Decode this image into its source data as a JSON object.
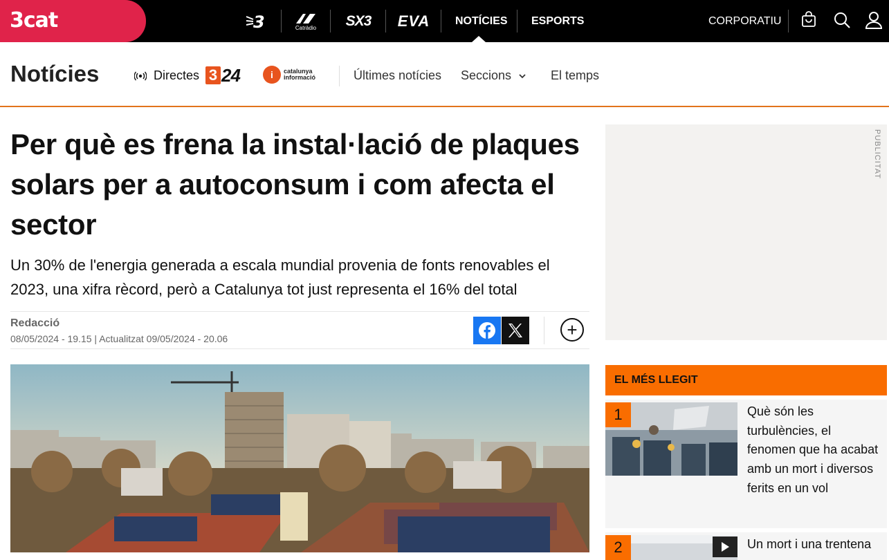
{
  "topbar": {
    "logo": "3cat",
    "channels": [
      "3",
      "Catràdio",
      "SX3",
      "EVA"
    ],
    "nav": {
      "noticies": "NOTÍCIES",
      "esports": "ESPORTS",
      "corporatiu": "CORPORATIU"
    },
    "icons": [
      "cart-icon",
      "search-icon",
      "user-icon"
    ],
    "brand_color": "#e0234a"
  },
  "section": {
    "title": "Notícies",
    "directes": "Directes",
    "logo_324": "24",
    "logo_324_three": "3",
    "catinfo_line1": "catalunya",
    "catinfo_line2": "informació",
    "links": {
      "ultimes": "Últimes notícies",
      "seccions": "Seccions",
      "temps": "El temps"
    },
    "accent_color": "#e2731b"
  },
  "article": {
    "headline": "Per què es frena la instal·lació de plaques solars per a autoconsum i com afecta el sector",
    "subhead": "Un 30% de l'energia generada a escala mundial provenia de fonts renovables el 2023, una xifra rècord, però a Catalunya tot just representa el 16% del total",
    "author": "Redacció",
    "dates": "08/05/2024 - 19.15 | Actualitzat 09/05/2024 - 20.06",
    "more": "+"
  },
  "sidebar": {
    "ad_label": "PUBLICITAT",
    "most_read_title": "EL MÉS LLEGIT",
    "most_read_color": "#f96d00",
    "items": [
      {
        "num": "1",
        "title": "Què són les turbulències, el fenomen que ha acabat amb un mort i diversos ferits en un vol"
      },
      {
        "num": "2",
        "title": "Un mort i una trentena"
      }
    ]
  }
}
